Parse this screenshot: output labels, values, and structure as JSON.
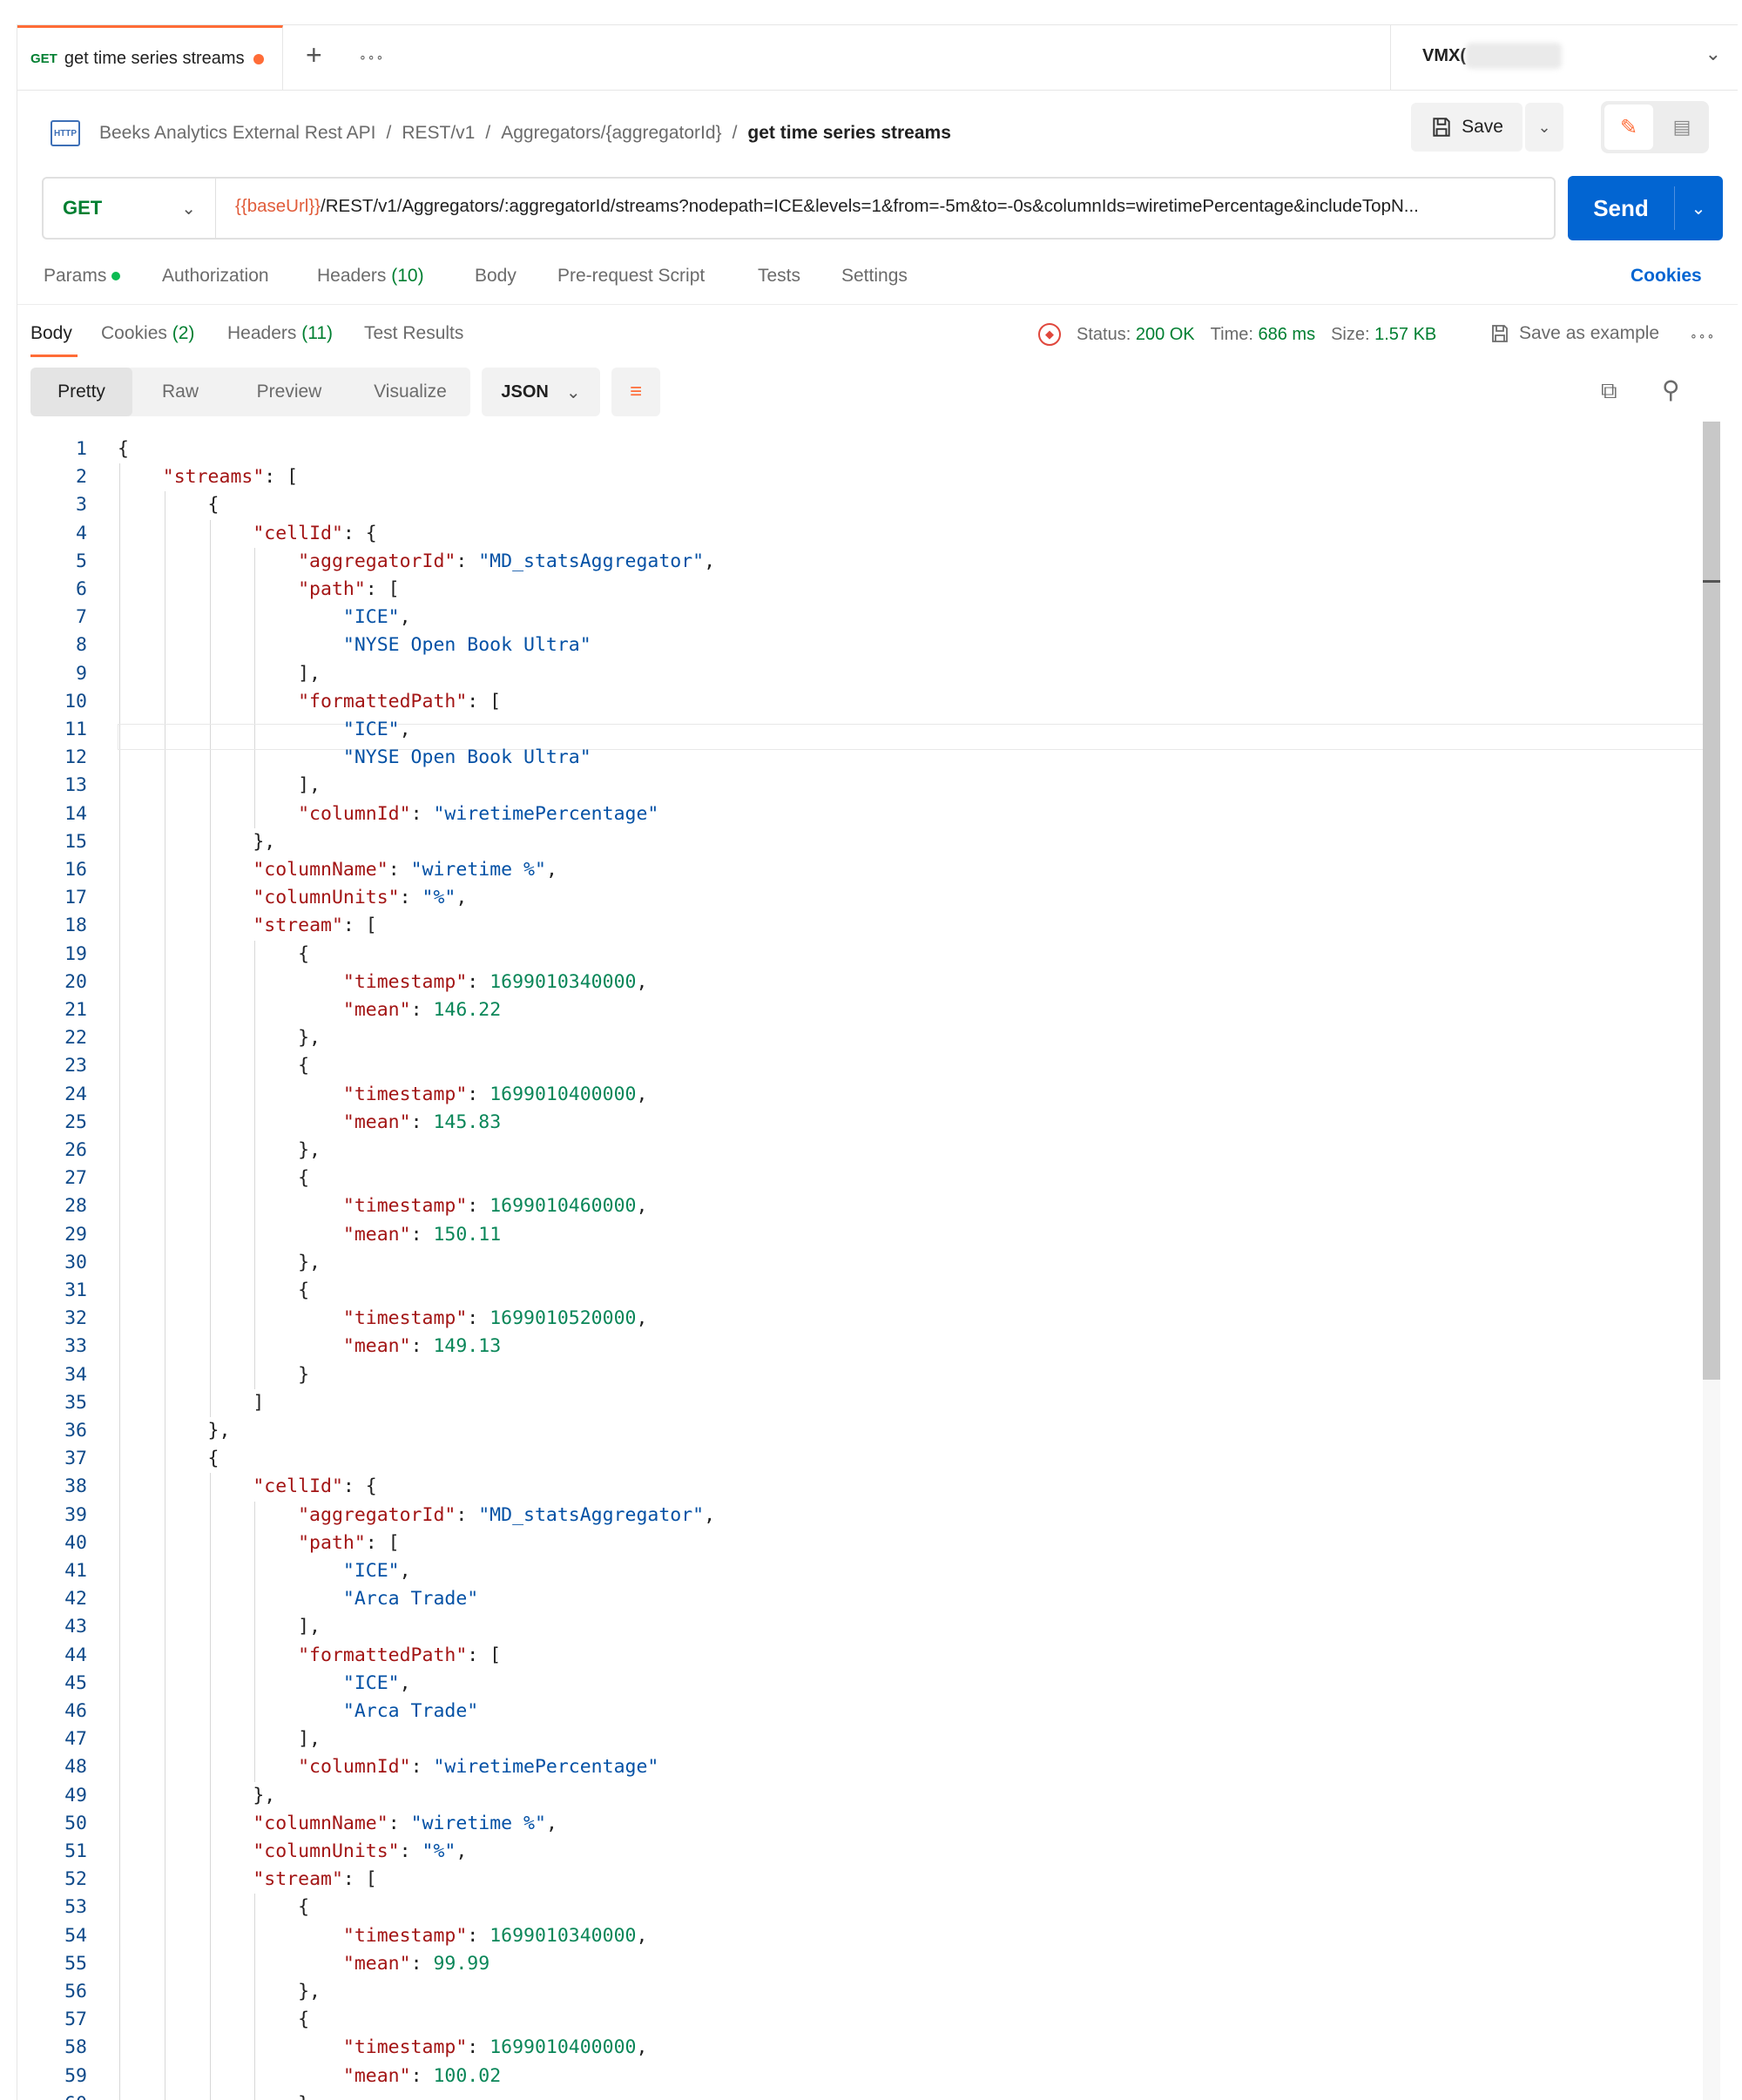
{
  "tab": {
    "method": "GET",
    "title": "get time series streams",
    "add_label": "+",
    "more_label": "∘∘∘"
  },
  "environment": {
    "name": "VMX("
  },
  "breadcrumb": {
    "icon_text": "HTTP",
    "items": [
      "Beeks Analytics External Rest API",
      "/",
      "REST/v1",
      "/",
      "Aggregators/{aggregatorId}",
      "/"
    ],
    "current": "get time series streams"
  },
  "toolbar": {
    "save_label": "Save"
  },
  "request": {
    "method": "GET",
    "url_var": "{{baseUrl}}",
    "url_rest": "/REST/v1/Aggregators/:aggregatorId/streams?nodepath=ICE&levels=1&from=-5m&to=-0s&columnIds=wiretimePercentage&includeTopN...",
    "send_label": "Send"
  },
  "request_tabs": {
    "params": "Params",
    "authorization": "Authorization",
    "headers": "Headers",
    "headers_count": "(10)",
    "body": "Body",
    "prerequest": "Pre-request Script",
    "tests": "Tests",
    "settings": "Settings",
    "cookies": "Cookies"
  },
  "response_tabs": {
    "body": "Body",
    "cookies": "Cookies",
    "cookies_count": "(2)",
    "headers": "Headers",
    "headers_count": "(11)",
    "test_results": "Test Results"
  },
  "response_status": {
    "status_label": "Status:",
    "status_value": "200 OK",
    "time_label": "Time:",
    "time_value": "686 ms",
    "size_label": "Size:",
    "size_value": "1.57 KB",
    "save_example": "Save as example"
  },
  "view_modes": {
    "pretty": "Pretty",
    "raw": "Raw",
    "preview": "Preview",
    "visualize": "Visualize",
    "format": "JSON"
  },
  "editor": {
    "lines": [
      "{",
      "    \"streams\": [",
      "        {",
      "            \"cellId\": {",
      "                \"aggregatorId\": \"MD_statsAggregator\",",
      "                \"path\": [",
      "                    \"ICE\",",
      "                    \"NYSE Open Book Ultra\"",
      "                ],",
      "                \"formattedPath\": [",
      "                    \"ICE\",",
      "                    \"NYSE Open Book Ultra\"",
      "                ],",
      "                \"columnId\": \"wiretimePercentage\"",
      "            },",
      "            \"columnName\": \"wiretime %\",",
      "            \"columnUnits\": \"%\",",
      "            \"stream\": [",
      "                {",
      "                    \"timestamp\": 1699010340000,",
      "                    \"mean\": 146.22",
      "                },",
      "                {",
      "                    \"timestamp\": 1699010400000,",
      "                    \"mean\": 145.83",
      "                },",
      "                {",
      "                    \"timestamp\": 1699010460000,",
      "                    \"mean\": 150.11",
      "                },",
      "                {",
      "                    \"timestamp\": 1699010520000,",
      "                    \"mean\": 149.13",
      "                }",
      "            ]",
      "        },",
      "        {",
      "            \"cellId\": {",
      "                \"aggregatorId\": \"MD_statsAggregator\",",
      "                \"path\": [",
      "                    \"ICE\",",
      "                    \"Arca Trade\"",
      "                ],",
      "                \"formattedPath\": [",
      "                    \"ICE\",",
      "                    \"Arca Trade\"",
      "                ],",
      "                \"columnId\": \"wiretimePercentage\"",
      "            },",
      "            \"columnName\": \"wiretime %\",",
      "            \"columnUnits\": \"%\",",
      "            \"stream\": [",
      "                {",
      "                    \"timestamp\": 1699010340000,",
      "                    \"mean\": 99.99",
      "                },",
      "                {",
      "                    \"timestamp\": 1699010400000,",
      "                    \"mean\": 100.02",
      "                },"
    ],
    "colors": {
      "key": "#a31515",
      "string": "#0451a5",
      "number": "#098658"
    }
  }
}
